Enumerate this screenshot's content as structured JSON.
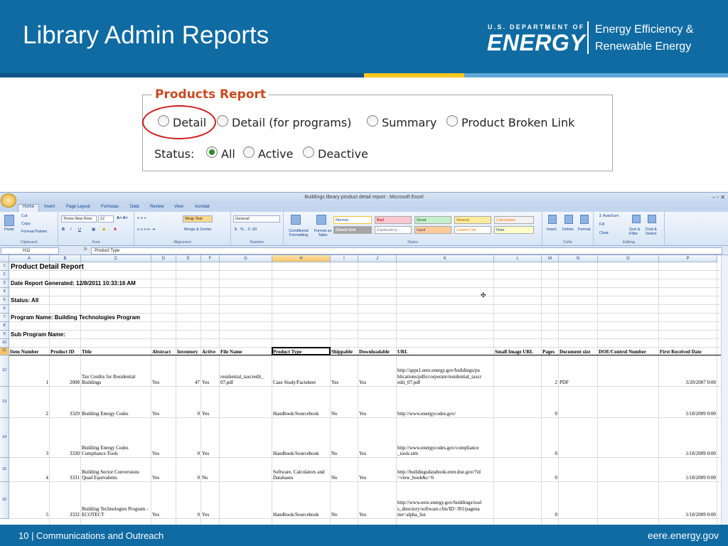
{
  "header": {
    "title": "Library Admin Reports",
    "logo_small": "U.S. DEPARTMENT OF",
    "logo_big": "ENERGY",
    "office_line1": "Energy Efficiency &",
    "office_line2": "Renewable Energy"
  },
  "colors": {
    "header_bg": "#0f6ba2",
    "accent_yellow": "#f7c71d",
    "report_legend": "#c94a1e",
    "highlight_ring": "#d11a1a"
  },
  "products_report": {
    "legend": "Products Report",
    "report_types": [
      {
        "label": "Detail",
        "selected": false
      },
      {
        "label": "Detail (for programs)",
        "selected": false
      },
      {
        "label": "Summary",
        "selected": false
      },
      {
        "label": "Product Broken Link",
        "selected": false
      }
    ],
    "status_label": "Status:",
    "statuses": [
      {
        "label": "All",
        "selected": true
      },
      {
        "label": "Active",
        "selected": false
      },
      {
        "label": "Deactive",
        "selected": false
      }
    ]
  },
  "excel": {
    "window_title": "Buildings library product detail report - Microsoft Excel",
    "tabs": [
      "Home",
      "Insert",
      "Page Layout",
      "Formulas",
      "Data",
      "Review",
      "View",
      "Acrobat"
    ],
    "groups": [
      "Clipboard",
      "Font",
      "Alignment",
      "Number",
      "Styles",
      "Cells",
      "Editing"
    ],
    "clipboard": {
      "paste": "Paste",
      "cut": "Cut",
      "copy": "Copy",
      "format_painter": "Format Painter"
    },
    "font": {
      "name": "Times New Rom",
      "size": "12"
    },
    "alignment": {
      "wrap": "Wrap Text",
      "merge": "Merge & Center"
    },
    "number": {
      "format": "General"
    },
    "styles": {
      "conditional": "Conditional Formatting",
      "format_table": "Format as Table",
      "cells": [
        "Normal",
        "Bad",
        "Good",
        "Neutral",
        "Calculation",
        "Check Cell",
        "Explanatory ...",
        "Input",
        "Linked Cell",
        "Note"
      ]
    },
    "cells_group": [
      "Insert",
      "Delete",
      "Format"
    ],
    "editing": {
      "autosum": "AutoSum",
      "fill": "Fill",
      "clear": "Clear",
      "sort": "Sort & Filter",
      "find": "Find & Select"
    },
    "name_box": "H11",
    "formula": "Product Type",
    "columns": [
      "A",
      "B",
      "C",
      "D",
      "E",
      "F",
      "G",
      "H",
      "I",
      "J",
      "K",
      "L",
      "M",
      "N",
      "O",
      "P"
    ],
    "meta_rows": [
      {
        "row": "1",
        "text": "Product Detail Report"
      },
      {
        "row": "3",
        "text": "Date Report Generated: 12/8/2011 10:33:16 AM"
      },
      {
        "row": "5",
        "text": "Status: All"
      },
      {
        "row": "7",
        "text": "Program Name: Building Technologies Program"
      },
      {
        "row": "9",
        "text": "Sub Program Name:"
      }
    ],
    "table_headers": [
      "Item Number",
      "Product ID",
      "Title",
      "Abstract",
      "Inventory",
      "Active",
      "File Name",
      "Product Type",
      "Shippable",
      "Downloadable",
      "URL",
      "Small Image URL",
      "Pages",
      "Document size",
      "DOE/Control Number",
      "First Received Date"
    ],
    "rows": [
      {
        "rownum": "12",
        "cells": [
          "1",
          "2008",
          "Tax Credits for Residential Buildings",
          "Yes",
          "47",
          "Yes",
          "residential_taxcredit_ 07.pdf",
          "Case Study/Factsheet",
          "Yes",
          "Yes",
          "http://apps1.eere.energy.gov/buildings/pu blications/pdfs/corporate/residential_taxcr edit_07.pdf",
          "",
          "2",
          "PDF",
          "",
          "3/20/2007 0:00"
        ]
      },
      {
        "rownum": "13",
        "cells": [
          "2",
          "3329",
          "Building Energy Codes",
          "Yes",
          "0",
          "Yes",
          "",
          "Handbook/Sourcebook",
          "No",
          "Yes",
          "http://www.energycodes.gov/",
          "",
          "0",
          "",
          "",
          "1/18/2009 0:00"
        ]
      },
      {
        "rownum": "14",
        "cells": [
          "3",
          "3330",
          "Building Energy Codes Compliance Tools",
          "Yes",
          "0",
          "Yes",
          "",
          "Handbook/Sourcebook",
          "No",
          "Yes",
          "http://www.energycodes.gov/compliance _tools.stm",
          "",
          "0",
          "",
          "",
          "1/18/2009 0:00"
        ]
      },
      {
        "rownum": "15",
        "cells": [
          "4",
          "3331",
          "Building Sector Conversions Quad Equivalents",
          "Yes",
          "0",
          "No",
          "",
          "Software, Calculators and Databases",
          "No",
          "Yes",
          "http://buildingsdatabook.eren.doe.gov/?id =view_book&c=6",
          "",
          "0",
          "",
          "",
          "1/18/2009 0:00"
        ]
      },
      {
        "rownum": "16",
        "cells": [
          "5",
          "3332",
          "Building Technologies Program - ECOTECT",
          "Yes",
          "0",
          "Yes",
          "",
          "Handbook/Sourcebook",
          "No",
          "Yes",
          "http://www.eere.energy.gov/buildings/tool s_directory/software.cfm/ID=391/pagena me=alpha_list",
          "",
          "0",
          "",
          "",
          "1/18/2009 0:00"
        ]
      }
    ]
  },
  "footer": {
    "left": "10 | Communications and Outreach",
    "right": "eere.energy.gov"
  }
}
